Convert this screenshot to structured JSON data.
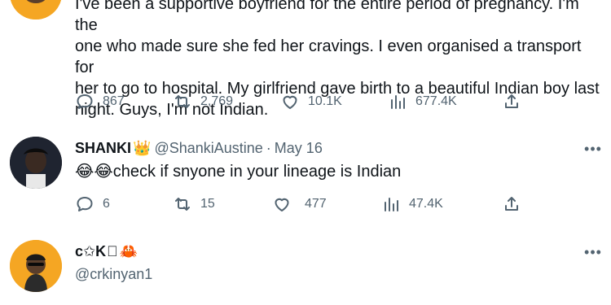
{
  "tweet1": {
    "text_lines": [
      "I've been a supportive boyfriend for the entire period of pregnancy. I'm the",
      "one who made sure she fed her cravings. I even organised a transport for",
      "her to go to hospital. My girlfriend gave birth to a beautiful Indian boy last",
      "night. Guys, I'm not Indian."
    ],
    "replies": "867",
    "retweets": "2,769",
    "likes": "10.1K",
    "views": "677.4K"
  },
  "tweet2": {
    "name": "SHANKI",
    "name_badge_icon": "crown-emoji",
    "handle": "@ShankiAustine",
    "separator": "·",
    "date": "May 16",
    "text": "😂😂check if snyone in your lineage is Indian",
    "replies": "6",
    "retweets": "15",
    "likes": "477",
    "views": "47.4K"
  },
  "tweet3": {
    "name": "c✩K",
    "name_badge_icon": "crab-emoji",
    "handle": "@crkinyan1"
  },
  "icons": {
    "reply": "reply-icon",
    "retweet": "retweet-icon",
    "like": "heart-icon",
    "views": "views-bar-chart-icon",
    "share": "share-icon",
    "more": "more-icon"
  },
  "colors": {
    "text": "#0f1419",
    "secondary": "#536471",
    "avatar_ring": "#f5a623"
  }
}
